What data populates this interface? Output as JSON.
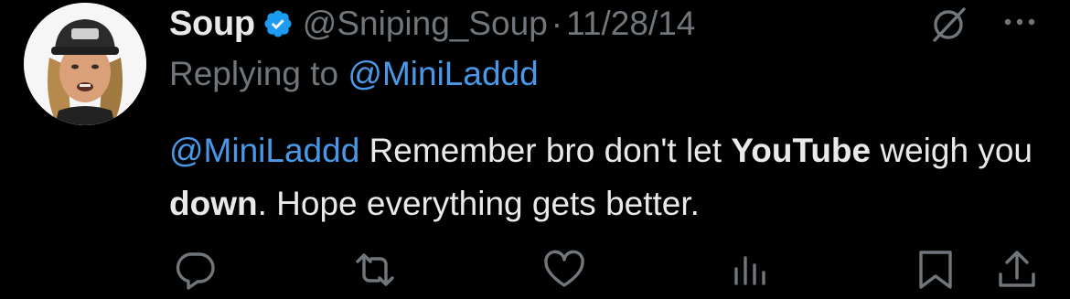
{
  "tweet": {
    "display_name": "Soup",
    "handle": "@Sniping_Soup",
    "separator": "·",
    "date": "11/28/14",
    "replying_prefix": "Replying to ",
    "replying_to": "@MiniLaddd",
    "text": {
      "mention": "@MiniLaddd",
      "part1": " Remember bro don't let ",
      "bold1": "YouTube",
      "part2": " weigh you ",
      "bold2": "down",
      "part3": ". Hope everything gets better."
    }
  },
  "icons": {
    "verified": "verified-badge-icon",
    "grok": "grok-icon",
    "more": "more-options-icon",
    "reply": "reply-icon",
    "retweet": "retweet-icon",
    "like": "like-icon",
    "views": "views-icon",
    "bookmark": "bookmark-icon",
    "share": "share-icon"
  },
  "colors": {
    "background": "#000000",
    "primary_text": "#e7e9ea",
    "secondary_text": "#71767b",
    "link": "#4a99e9",
    "verified": "#1d9bf0"
  }
}
